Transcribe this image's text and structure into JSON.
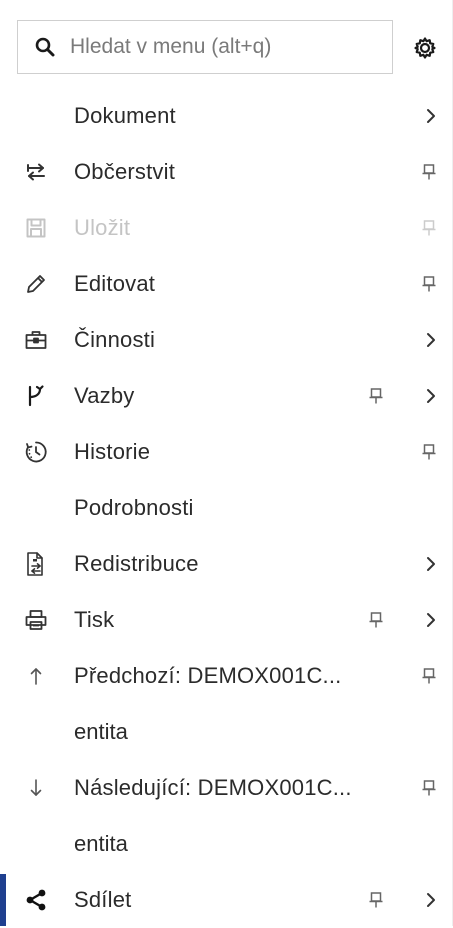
{
  "search": {
    "placeholder": "Hledat v menu (alt+q)",
    "value": ""
  },
  "colors": {
    "text": "#2b2b2b",
    "disabled_text": "#c4c4c4",
    "border": "#cfcfcf",
    "active_indicator": "#1f3f8f",
    "icon": "#333333",
    "icon_light": "#8a8a8a"
  },
  "menu": {
    "items": [
      {
        "label": "Dokument",
        "icon": "none",
        "pin": false,
        "submenu": true
      },
      {
        "label": "Občerstvit",
        "icon": "refresh-arrows-icon",
        "pin": true,
        "submenu": false
      },
      {
        "label": "Uložit",
        "icon": "save-icon",
        "pin": true,
        "submenu": false,
        "disabled": true
      },
      {
        "label": "Editovat",
        "icon": "pencil-icon",
        "pin": true,
        "submenu": false
      },
      {
        "label": "Činnosti",
        "icon": "toolbox-icon",
        "pin": false,
        "submenu": true
      },
      {
        "label": "Vazby",
        "icon": "branch-icon",
        "pin": true,
        "submenu": true
      },
      {
        "label": "Historie",
        "icon": "history-clock-icon",
        "pin": true,
        "submenu": false
      },
      {
        "label": "Podrobnosti",
        "icon": "none",
        "pin": false,
        "submenu": false
      },
      {
        "label": "Redistribuce",
        "icon": "document-redistribute-icon",
        "pin": false,
        "submenu": true
      },
      {
        "label": "Tisk",
        "icon": "printer-icon",
        "pin": true,
        "submenu": true
      },
      {
        "label": "Předchozí: DEMOX001C...",
        "sublabel": "entita",
        "icon": "arrow-up-icon",
        "pin": true,
        "submenu": false
      },
      {
        "label": "Následující: DEMOX001C...",
        "sublabel": "entita",
        "icon": "arrow-down-icon",
        "pin": true,
        "submenu": false
      },
      {
        "label": "Sdílet",
        "icon": "share-icon",
        "pin": true,
        "submenu": true,
        "active": true
      }
    ]
  }
}
